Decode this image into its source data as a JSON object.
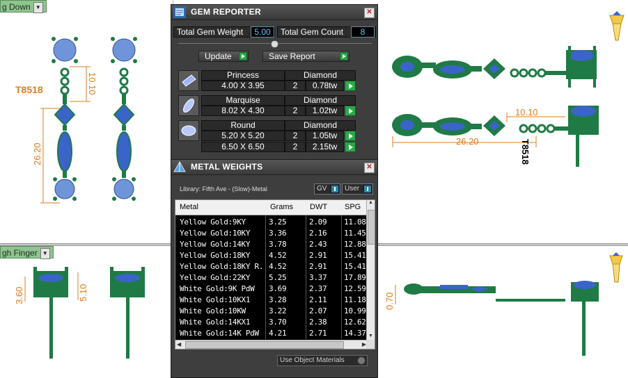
{
  "viewports": {
    "top_left_label": "g Down",
    "bottom_left_label": "gh Finger"
  },
  "annotations": {
    "tag_left": "T8518",
    "tag_right": "T8518",
    "dim_top_left_1": "10.10",
    "dim_top_left_2": "26.20",
    "dim_top_right_1": "10.10",
    "dim_top_right_2": "26.20",
    "dim_bot_left_1": "3.60",
    "dim_bot_left_2": "5.10",
    "dim_bot_right_1": "0.70"
  },
  "gem_reporter": {
    "title": "GEM REPORTER",
    "total_weight_label": "Total Gem Weight",
    "total_weight_value": "5.00",
    "total_count_label": "Total Gem Count",
    "total_count_value": "8",
    "update_label": "Update",
    "save_label": "Save Report",
    "gems": [
      {
        "shape": "Princess",
        "material": "Diamond",
        "rows": [
          {
            "size": "4.00 X 3.95",
            "qty": "2",
            "weight": "0.78tw"
          }
        ]
      },
      {
        "shape": "Marquise",
        "material": "Diamond",
        "rows": [
          {
            "size": "8.02 X 4.30",
            "qty": "2",
            "weight": "1.02tw"
          }
        ]
      },
      {
        "shape": "Round",
        "material": "Diamond",
        "rows": [
          {
            "size": "5.20 X 5.20",
            "qty": "2",
            "weight": "1.05tw"
          },
          {
            "size": "6.50 X 6.50",
            "qty": "2",
            "weight": "2.15tw"
          }
        ]
      }
    ]
  },
  "metal_weights": {
    "title": "METAL WEIGHTS",
    "library": "Library: Fifth Ave - (Slow)-Metal",
    "toggle_gv": "GV",
    "toggle_user": "User",
    "columns": [
      "Metal",
      "Grams",
      "DWT",
      "SPG"
    ],
    "rows": [
      [
        "Yellow Gold:9KY",
        "3.25",
        "2.09",
        "11.08"
      ],
      [
        "Yellow Gold:10KY",
        "3.36",
        "2.16",
        "11.45"
      ],
      [
        "Yellow Gold:14KY",
        "3.78",
        "2.43",
        "12.88"
      ],
      [
        "Yellow Gold:18KY",
        "4.52",
        "2.91",
        "15.41"
      ],
      [
        "Yellow Gold:18KY R...",
        "4.52",
        "2.91",
        "15.41"
      ],
      [
        "Yellow Gold:22KY",
        "5.25",
        "3.37",
        "17.89"
      ],
      [
        "White Gold:9K PdW",
        "3.69",
        "2.37",
        "12.59"
      ],
      [
        "White Gold:10KX1",
        "3.28",
        "2.11",
        "11.18"
      ],
      [
        "White Gold:10KW",
        "3.22",
        "2.07",
        "10.99"
      ],
      [
        "White Gold:14KX1",
        "3.70",
        "2.38",
        "12.62"
      ],
      [
        "White Gold:14K PdW",
        "4.21",
        "2.71",
        "14.37"
      ]
    ],
    "use_object_materials": "Use Object Materials"
  }
}
